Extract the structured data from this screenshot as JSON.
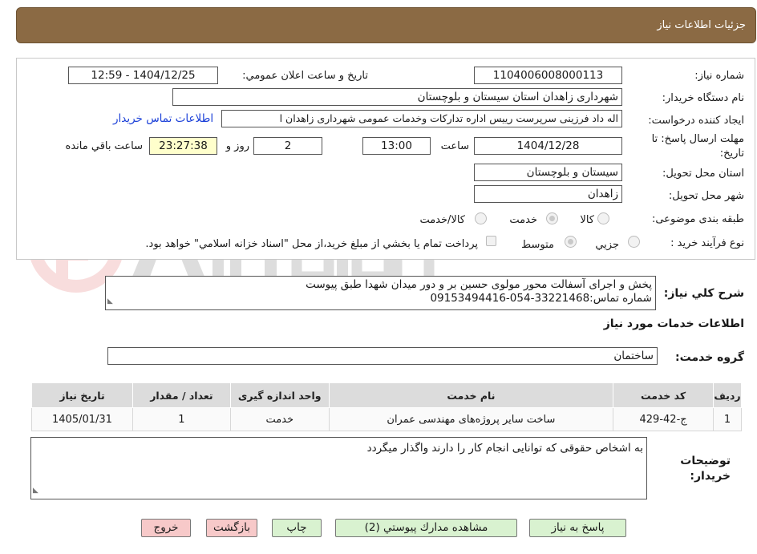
{
  "header": {
    "title": "جزئیات اطلاعات نیاز"
  },
  "form": {
    "need_number_label": "شماره نیاز:",
    "need_number": "1104006008000113",
    "announce_label": "تاریخ و ساعت اعلان عمومي:",
    "announce_value": "1404/12/25 - 12:59",
    "buyer_org_label": "نام دستگاه خريدار:",
    "buyer_org": "شهرداری زاهدان استان سیستان و بلوچستان",
    "creator_label": "ايجاد كننده درخواست:",
    "creator": "اله داد فرزینی سرپرست رییس اداره تدارکات وخدمات عمومی شهرداری زاهدان ا",
    "contact_link": "اطلاعات تماس خريدار",
    "deadline_label_1": "مهلت ارسال پاسخ: تا",
    "deadline_label_2": "تاریخ:",
    "deadline_date": "1404/12/28",
    "time_word": "ساعت",
    "deadline_time": "13:00",
    "days_value": "2",
    "days_word": "روز و",
    "remaining_time": "23:27:38",
    "remaining_word": "ساعت باقي مانده",
    "province_label": "استان محل تحويل:",
    "province": "سيستان و بلوچستان",
    "city_label": "شهر محل تحويل:",
    "city": "زاهدان",
    "category_label": "طبقه بندی موضوعی:",
    "category_options": [
      "كالا",
      "خدمت",
      "كالا/خدمت"
    ],
    "process_label": "نوع فرآيند خريد :",
    "process_options": [
      "جزيي",
      "متوسط"
    ],
    "payment_note": "پرداخت تمام يا بخشي از مبلغ خريد،از محل \"اسناد خزانه اسلامي\" خواهد بود."
  },
  "description": {
    "label": "شرح كلي نياز:",
    "line1": "پخش و اجرای آسفالت محور مولوی حسین بر و دور میدان شهدا طبق پیوست",
    "line2": "شماره تماس:33221468-054-09153494416"
  },
  "services": {
    "section_title": "اطلاعات خدمات مورد نياز",
    "group_label": "گروه خدمت:",
    "group_value": "ساختمان",
    "columns": [
      "رديف",
      "كد خدمت",
      "نام خدمت",
      "واحد اندازه گيری",
      "تعداد / مقدار",
      "تاريخ نياز"
    ],
    "rows": [
      {
        "index": "1",
        "code": "ج-42-429",
        "name": "ساخت سایر پروژه‌های مهندسی عمران",
        "unit": "خدمت",
        "qty": "1",
        "date": "1405/01/31"
      }
    ]
  },
  "buyer_notes": {
    "label_1": "توضيحات",
    "label_2": "خريدار:",
    "text": "به اشخاص حقوقی که توانایی انجام کار را دارند واگذار میگردد"
  },
  "buttons": {
    "reply": "پاسخ به نياز",
    "attachments": "مشاهده مدارك پيوستي (2)",
    "print": "چاپ",
    "back": "بازگشت",
    "exit": "خروج"
  },
  "colors": {
    "header_bg": "#8b6a44",
    "link": "#1a3fd8",
    "green_button": "#d9f2d0",
    "red_button": "#f7c9c9",
    "remaining_bg": "#ffffcc"
  }
}
